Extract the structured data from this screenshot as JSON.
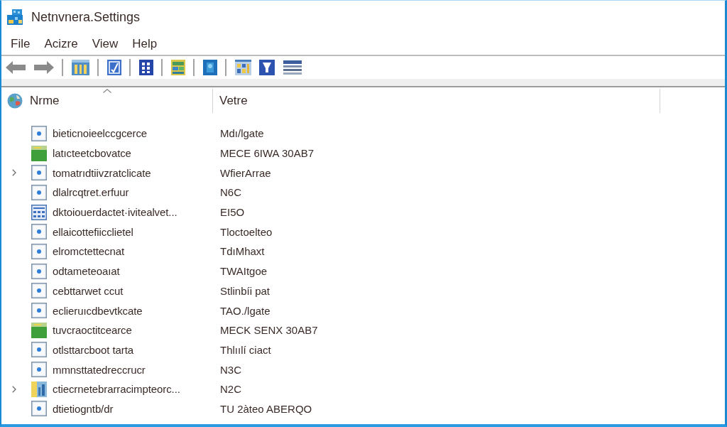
{
  "window": {
    "title": "Netnvnera.Settings"
  },
  "menu": [
    "File",
    "Acizre",
    "View",
    "Help"
  ],
  "table": {
    "columns": [
      {
        "label": "Nrme",
        "sorted": true
      },
      {
        "label": "Vetre",
        "sorted": false
      }
    ],
    "rows": [
      {
        "kind": "file",
        "name": "bieticnoieelccgcerce",
        "value": "Mdı/lgate",
        "expandable": false
      },
      {
        "kind": "image",
        "name": "latıcteetcbovatce",
        "value": "MECE 6IWA 30AB7",
        "expandable": false
      },
      {
        "kind": "file",
        "name": "tomatrıdtiivzratclicate",
        "value": "WfierArrae",
        "expandable": true
      },
      {
        "kind": "file",
        "name": "dlalrcqtret.erfuur",
        "value": "N6C",
        "expandable": false
      },
      {
        "kind": "grid",
        "name": "dktoiouerdactet·ivitealvet...",
        "value": "EI5O",
        "expandable": false
      },
      {
        "kind": "file",
        "name": "ellaicottefiicclietel",
        "value": "Tloctoelteo",
        "expandable": false
      },
      {
        "kind": "file",
        "name": "elromctettecnat",
        "value": "TdıMhaxt",
        "expandable": false
      },
      {
        "kind": "file",
        "name": "odtameteoaıat",
        "value": "TWAItgoe",
        "expandable": false
      },
      {
        "kind": "file",
        "name": "cebttarwet ccut",
        "value": "Stlinbíi pat",
        "expandable": false
      },
      {
        "kind": "file",
        "name": "eclieruıcdbevtkcate",
        "value": "TAO./lgate",
        "expandable": false
      },
      {
        "kind": "image",
        "name": "tuvcraoctitcearce",
        "value": "MECK SENX 30AB7",
        "expandable": false
      },
      {
        "kind": "file",
        "name": "otlsttarcboot tarta",
        "value": "Thlıılí ciact",
        "expandable": false
      },
      {
        "kind": "file",
        "name": "mmnsttatedreccrucr",
        "value": "N3C",
        "expandable": false
      },
      {
        "kind": "picture",
        "name": "ctiecrnetebrarracimpteorc...",
        "value": "N2C",
        "expandable": true
      },
      {
        "kind": "file",
        "name": "dtietiogntb/dr",
        "value": "TU 2àteo ABERQO",
        "expandable": false
      }
    ]
  }
}
